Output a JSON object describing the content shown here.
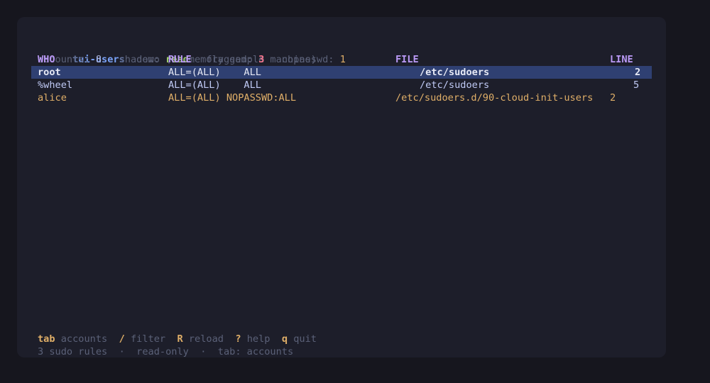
{
  "header": {
    "app_name": "tui-users",
    "subtitle": "demo (in-memory sample machine)"
  },
  "stats": {
    "accounts_label": "accounts:",
    "accounts_value": "8",
    "shadow_label": "shadow:",
    "shadow_value": "read",
    "flagged_label": "flagged:",
    "flagged_value": "3",
    "nopasswd_label": "nopasswd:",
    "nopasswd_value": "1"
  },
  "table": {
    "columns": [
      "WHO",
      "RULE",
      "FILE",
      "LINE"
    ],
    "rows": [
      {
        "who": "root",
        "rule": "ALL=(ALL)    ALL",
        "file": "/etc/sudoers",
        "line": "2",
        "state": "selected"
      },
      {
        "who": "%wheel",
        "rule": "ALL=(ALL)    ALL",
        "file": "/etc/sudoers",
        "line": "5",
        "state": "normal"
      },
      {
        "who": "alice",
        "rule": "ALL=(ALL) NOPASSWD:ALL",
        "file": "/etc/sudoers.d/90-cloud-init-users",
        "line": "2",
        "state": "flagged"
      }
    ]
  },
  "keybar": [
    {
      "key": "tab",
      "label": "accounts"
    },
    {
      "key": "/",
      "label": "filter"
    },
    {
      "key": "R",
      "label": "reload"
    },
    {
      "key": "?",
      "label": "help"
    },
    {
      "key": "q",
      "label": "quit"
    }
  ],
  "status": {
    "rules_count": "3 sudo rules",
    "sep": "·",
    "mode": "read-only",
    "tab_info": "tab: accounts"
  },
  "colors": {
    "background": "#16161e",
    "terminal": "#1d1e2a",
    "selection": "#2f4072",
    "accent": "#7aa2f7",
    "header": "#bb9af7",
    "flagged": "#e0af68",
    "ok": "#9ece6a",
    "alert": "#f7768e"
  }
}
